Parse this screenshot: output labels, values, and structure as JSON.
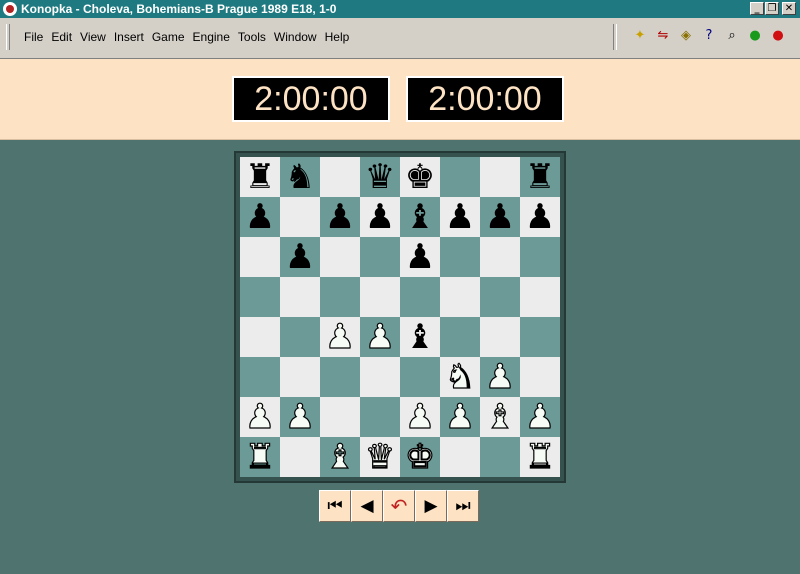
{
  "window": {
    "title": "Konopka - Choleva, Bohemians-B Prague 1989  E18, 1-0",
    "minimize": "_",
    "restore": "❐",
    "close": "✕"
  },
  "menu": [
    "File",
    "Edit",
    "View",
    "Insert",
    "Game",
    "Engine",
    "Tools",
    "Window",
    "Help"
  ],
  "toolbar": [
    {
      "icon": "new-game-icon",
      "glyph": "✦",
      "color": "#c8a000"
    },
    {
      "icon": "flip-board-icon",
      "glyph": "⇋",
      "color": "#b00000"
    },
    {
      "icon": "hint-icon",
      "glyph": "◈",
      "color": "#8a7000"
    },
    {
      "icon": "help-search-icon",
      "glyph": "?",
      "color": "#000080"
    },
    {
      "icon": "analyze-icon",
      "glyph": "⌕",
      "color": "#000000"
    },
    {
      "icon": "ok-icon",
      "glyph": "●",
      "color": "#1a9a1a"
    },
    {
      "icon": "stop-icon",
      "glyph": "●",
      "color": "#d01010"
    }
  ],
  "clocks": {
    "white": "2:00:00",
    "black": "2:00:00"
  },
  "board": {
    "light_color": "#ececec",
    "dark_color": "#6b9a97",
    "ranks": [
      [
        {
          "p": "♜",
          "c": "b"
        },
        {
          "p": "♞",
          "c": "b"
        },
        null,
        {
          "p": "♛",
          "c": "b"
        },
        {
          "p": "♚",
          "c": "b"
        },
        null,
        null,
        {
          "p": "♜",
          "c": "b"
        }
      ],
      [
        {
          "p": "♟",
          "c": "b"
        },
        null,
        {
          "p": "♟",
          "c": "b"
        },
        {
          "p": "♟",
          "c": "b"
        },
        {
          "p": "♝",
          "c": "b"
        },
        {
          "p": "♟",
          "c": "b"
        },
        {
          "p": "♟",
          "c": "b"
        },
        {
          "p": "♟",
          "c": "b"
        }
      ],
      [
        null,
        {
          "p": "♟",
          "c": "b"
        },
        null,
        null,
        {
          "p": "♟",
          "c": "b"
        },
        null,
        null,
        null
      ],
      [
        null,
        null,
        null,
        null,
        null,
        null,
        null,
        null
      ],
      [
        null,
        null,
        {
          "p": "♟",
          "c": "w"
        },
        {
          "p": "♟",
          "c": "w"
        },
        {
          "p": "♝",
          "c": "b"
        },
        null,
        null,
        null
      ],
      [
        null,
        null,
        null,
        null,
        null,
        {
          "p": "♞",
          "c": "w"
        },
        {
          "p": "♟",
          "c": "w"
        },
        null
      ],
      [
        {
          "p": "♟",
          "c": "w"
        },
        {
          "p": "♟",
          "c": "w"
        },
        null,
        null,
        {
          "p": "♟",
          "c": "w"
        },
        {
          "p": "♟",
          "c": "w"
        },
        {
          "p": "♝",
          "c": "w"
        },
        {
          "p": "♟",
          "c": "w"
        }
      ],
      [
        {
          "p": "♜",
          "c": "w"
        },
        null,
        {
          "p": "♝",
          "c": "w"
        },
        {
          "p": "♛",
          "c": "w"
        },
        {
          "p": "♚",
          "c": "w"
        },
        null,
        null,
        {
          "p": "♜",
          "c": "w"
        }
      ]
    ]
  },
  "navigation": [
    {
      "name": "first-move-button",
      "glyph": "⏮"
    },
    {
      "name": "previous-move-button",
      "glyph": "◀"
    },
    {
      "name": "take-back-button",
      "glyph": "↶"
    },
    {
      "name": "next-move-button",
      "glyph": "▶"
    },
    {
      "name": "last-move-button",
      "glyph": "⏭"
    }
  ]
}
